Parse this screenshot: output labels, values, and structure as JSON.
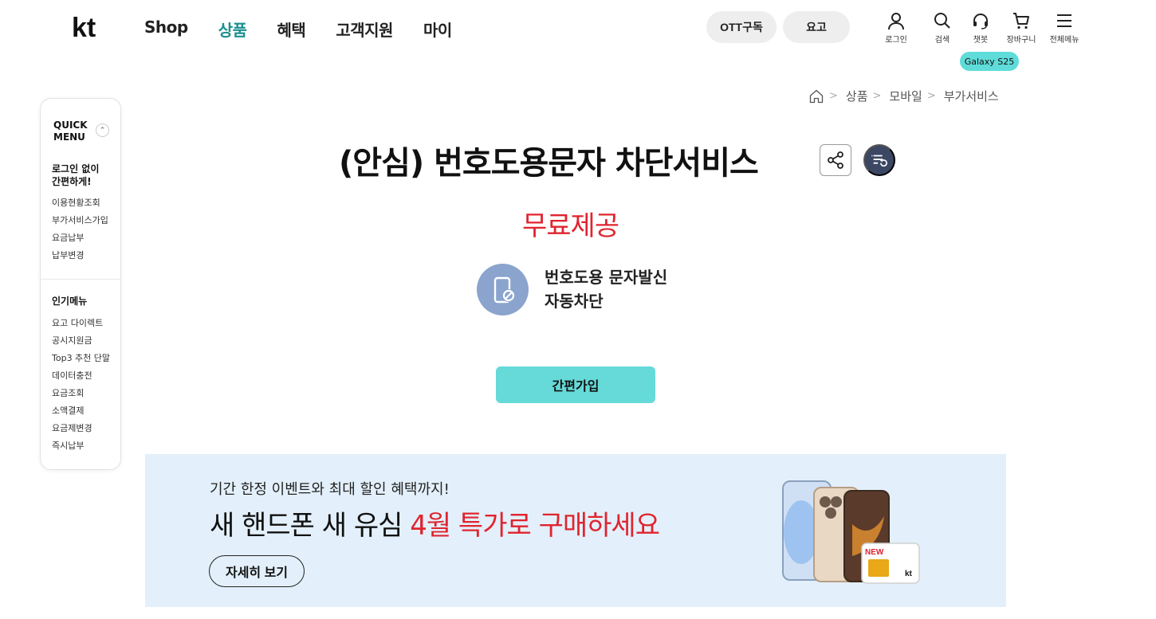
{
  "header": {
    "logo_text": "kt",
    "nav": [
      "Shop",
      "상품",
      "혜택",
      "고객지원",
      "마이"
    ],
    "active_nav_index": 1,
    "pills": {
      "ott": "OTT구독",
      "yogo": "요고"
    },
    "utils": [
      {
        "icon": "person-icon",
        "label": "로그인"
      },
      {
        "icon": "search-icon",
        "label": "검색"
      },
      {
        "icon": "headset-icon",
        "label": "챗봇"
      },
      {
        "icon": "cart-icon",
        "label": "장바구니"
      },
      {
        "icon": "menu-icon",
        "label": "전체메뉴"
      }
    ],
    "badge": "Galaxy S25"
  },
  "breadcrumb": [
    "상품",
    "모바일",
    "부가서비스"
  ],
  "quick_menu": {
    "title_line1": "QUICK",
    "title_line2": "MENU",
    "section1_line1": "로그인 없이",
    "section1_line2": "간편하게!",
    "section1_items": [
      "이용현황조회",
      "부가서비스가입",
      "요금납부",
      "납부변경"
    ],
    "section2_title": "인기메뉴",
    "section2_items": [
      "요고 다이렉트",
      "공시지원금",
      "Top3 추천 단말",
      "데이터충전",
      "요금조회",
      "소액결제",
      "요금제변경",
      "즉시납부"
    ]
  },
  "product": {
    "title": "(안심) 번호도용문자 차단서비스",
    "price": "무료제공",
    "feature_line1": "번호도용 문자발신",
    "feature_line2": "자동차단",
    "join_label": "간편가입"
  },
  "banner": {
    "subtitle": "기간 한정 이벤트와 최대 할인 혜택까지!",
    "main_prefix": "새 핸드폰 새 유심 ",
    "main_highlight": "4월 특가로 구매하세요",
    "button": "자세히 보기",
    "sim_label": "NEW",
    "sim_brand": "kt"
  },
  "colors": {
    "accent": "#65dad8",
    "active_nav": "#1a8f8f",
    "price_red": "#e0242f",
    "banner_bg": "#e3f0fb"
  }
}
